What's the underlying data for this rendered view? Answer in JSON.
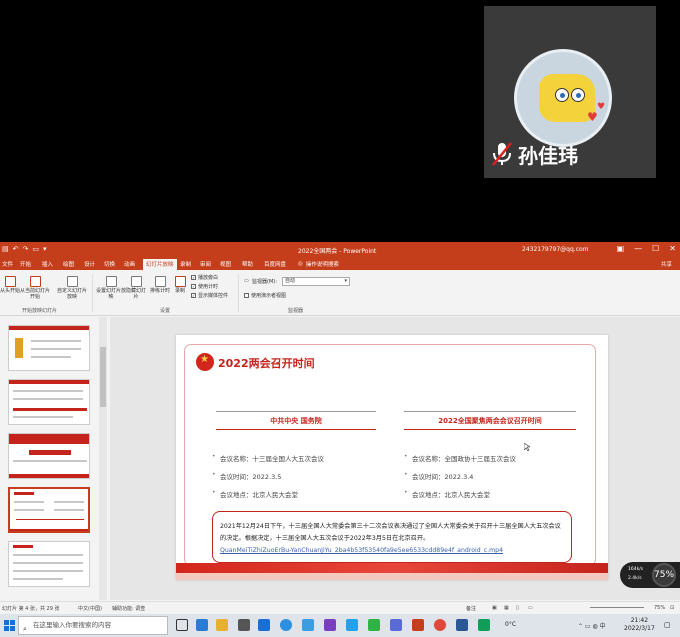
{
  "video": {
    "participant_name": "孙佳玮",
    "mic_state": "muted"
  },
  "window": {
    "title": "2022全国两会 - PowerPoint",
    "account": "2432179797@qq.com",
    "share": "共享"
  },
  "menu": {
    "tabs": [
      "文件",
      "开始",
      "插入",
      "绘图",
      "设计",
      "切换",
      "动画",
      "幻灯片放映",
      "录制",
      "审阅",
      "视图",
      "帮助",
      "百度网盘"
    ],
    "active_tab": "幻灯片放映",
    "tell_me": "操作说明搜索"
  },
  "ribbon": {
    "buttons": {
      "from_beginning": "从头开始",
      "from_current": "从当前幻灯片开始",
      "custom": "自定义幻灯片放映",
      "setup": "设置幻灯片放映",
      "hide": "隐藏幻灯片",
      "rehearse": "排练计时",
      "record": "录制"
    },
    "checkboxes": [
      {
        "label": "播放旁白",
        "checked": true
      },
      {
        "label": "使用计时",
        "checked": true
      },
      {
        "label": "显示媒体控件",
        "checked": true
      }
    ],
    "monitor_label": "监视器(M):",
    "monitor_value": "自动",
    "presenter_view_label": "使用演示者视图",
    "groups": [
      "开始放映幻灯片",
      "设置",
      "监视器"
    ]
  },
  "thumbnails": {
    "items": [
      {
        "num": "",
        "selected": false
      },
      {
        "num": "",
        "selected": false
      },
      {
        "num": "",
        "selected": false
      },
      {
        "num": "",
        "selected": true
      },
      {
        "num": "",
        "selected": false
      }
    ]
  },
  "slide": {
    "title": "2022两会召开时间",
    "left": {
      "heading": "中共中央  国务院",
      "rows": [
        "会议名称：十三届全国人大五次会议",
        "会议时间：2022.3.5",
        "会议地点：北京人民大会堂"
      ]
    },
    "right": {
      "heading": "2022全国聚焦两会会议召开时间",
      "rows": [
        "会议名称：全国政协十三届五次会议",
        "会议时间：2022.3.4",
        "会议地点：北京人民大会堂"
      ]
    },
    "description": "2021年12月24日下午，十三届全国人大常委会第三十二次会议表决通过了全国人大常委会关于召开十三届全国人大五次会议的决定。根据决定，十三届全国人大五次会议于2022年3月5日在北京召开。",
    "link": "QuanMeiTiZhiZuoErBu-YanChuanJiYu_2ba4b53f53540fa9e5ee6533cdd89e4f_android_c.mp4"
  },
  "network": {
    "up": "164k/s",
    "down": "2.4k/s",
    "percent": "75%"
  },
  "status": {
    "slide_info": "幻灯片 第 4 张，共 29 张",
    "language": "中文(中国)",
    "accessibility": "辅助功能: 调查",
    "notes": "备注",
    "zoom": "75%"
  },
  "taskbar": {
    "search_placeholder": "在这里输入你要搜索的内容",
    "weather": "0°C",
    "time": "21:42",
    "date": "2022/3/17"
  }
}
